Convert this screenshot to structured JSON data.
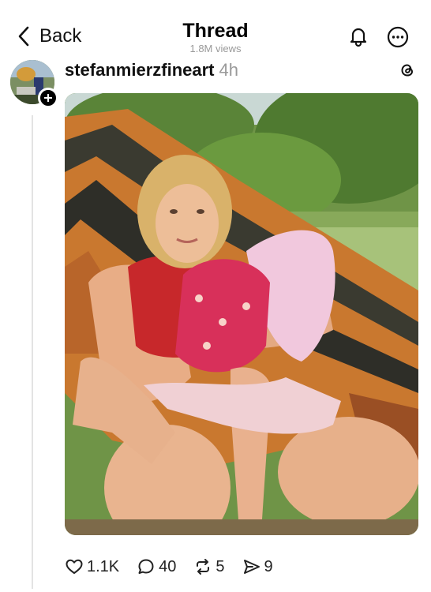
{
  "header": {
    "back_label": "Back",
    "title": "Thread",
    "views": "1.8M views"
  },
  "post": {
    "username": "stefanmierzfineart",
    "time": "4h"
  },
  "actions": {
    "likes": "1.1K",
    "replies": "40",
    "reposts": "5",
    "shares": "9"
  },
  "icons": [
    "chevron-left-icon",
    "bell-icon",
    "more-icon",
    "threads-logo-icon",
    "plus-icon",
    "heart-icon",
    "comment-icon",
    "repost-icon",
    "share-icon"
  ]
}
